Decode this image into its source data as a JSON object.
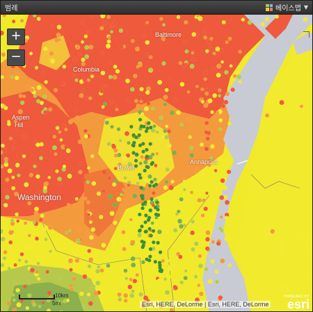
{
  "window": {
    "title": "범례",
    "basemap_label": "베이스맵"
  },
  "zoom": {
    "in_label": "+",
    "out_label": "−"
  },
  "places": {
    "baltimore": "Baltimore",
    "columbia": "Columbia",
    "aspen_hill_1": "Aspen",
    "aspen_hill_2": "Hill",
    "bowie": "Bowie",
    "annapolis": "Annapolis",
    "washington": "Washington"
  },
  "scale": {
    "km_label": "10km",
    "mi_label": "5mi"
  },
  "attribution": "Esri, HERE, DeLorme | Esri, HERE, DeLorme",
  "esri": {
    "powered_by": "POWERED BY",
    "logo": "esri"
  },
  "colors": {
    "red": "#ef5b3a",
    "orange": "#f59a3a",
    "yellow": "#f2ea2c",
    "lightgreen": "#b3cc4c",
    "green": "#7bb04a",
    "water": "#c9ccd4"
  }
}
